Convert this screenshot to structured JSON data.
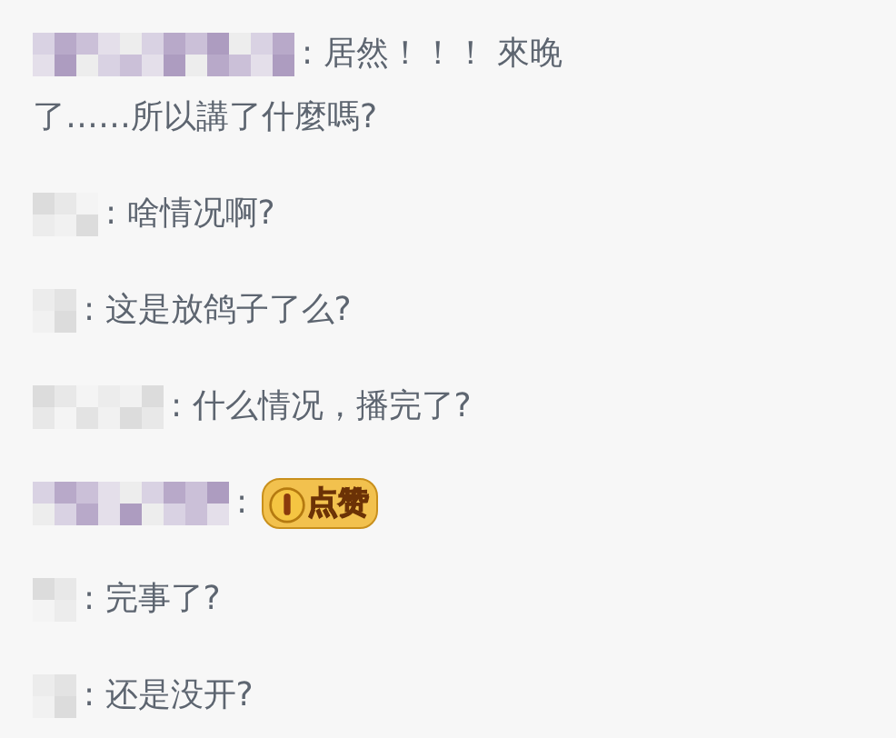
{
  "messages": [
    {
      "kind": "text",
      "lines": [
        ": 居然！！！ 來晚",
        "了……所以講了什麼嗎?"
      ]
    },
    {
      "kind": "text",
      "lines": [
        ": 啥情况啊?"
      ]
    },
    {
      "kind": "text",
      "lines": [
        ": 这是放鸽子了么?"
      ]
    },
    {
      "kind": "text",
      "lines": [
        ": 什么情况，播完了?"
      ]
    },
    {
      "kind": "sticker",
      "lines": [
        ":"
      ],
      "sticker": "点赞"
    },
    {
      "kind": "text",
      "lines": [
        ": 完事了?"
      ]
    },
    {
      "kind": "text",
      "lines": [
        ": 还是没开?"
      ]
    }
  ]
}
